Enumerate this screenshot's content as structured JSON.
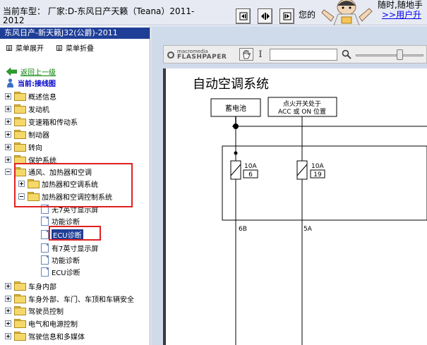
{
  "header": {
    "model_line1": "当前车型：  厂家:D-东风日产天籁（Teana）2011-",
    "model_line2": "2012",
    "notice_fragment": "您的",
    "slogan": "随时,随地手",
    "user_center": ">>用户升"
  },
  "sidebar": {
    "title": "东风日产-新天籁J32(公爵)-2011",
    "expand_all": "菜单展开",
    "collapse_all": "菜单折叠",
    "back": "返回上一级",
    "current": "当前:接线图",
    "items": [
      {
        "label": "概述信息"
      },
      {
        "label": "发动机"
      },
      {
        "label": "变速箱和传动系"
      },
      {
        "label": "制动器"
      },
      {
        "label": "转向"
      },
      {
        "label": "保护系统"
      },
      {
        "label": "通风、加热器和空调"
      },
      {
        "label": "加热器和空调系统"
      },
      {
        "label": "加热器和空调控制系统"
      },
      {
        "label": "无7英寸显示屏"
      },
      {
        "label": "功能诊断"
      },
      {
        "label": "ECU诊断"
      },
      {
        "label": "有7英寸显示屏"
      },
      {
        "label": "功能诊断"
      },
      {
        "label": "ECU诊断"
      },
      {
        "label": "车身内部"
      },
      {
        "label": "车身外部、车门、车顶和车辆安全"
      },
      {
        "label": "驾驶员控制"
      },
      {
        "label": "电气和电源控制"
      },
      {
        "label": "驾驶信息和多媒体"
      }
    ]
  },
  "viewer": {
    "logo_brand": "macromedia",
    "logo_product": "FLASHPAPER",
    "search_value": "",
    "zoom_level": 0.65
  },
  "document": {
    "title": "自动空调系统",
    "battery_label": "蓄电池",
    "ignition_label_1": "点火开关处于",
    "ignition_label_2": "ACC 或 ON 位置",
    "fuses": [
      {
        "amps": "10A",
        "number": "6",
        "wire": "6B"
      },
      {
        "amps": "10A",
        "number": "19",
        "wire": "5A"
      }
    ]
  },
  "colors": {
    "highlight_box": "#e02020",
    "sidebar_title_bg": "#1f3f97",
    "viewer_bg": "#cfdaeb"
  }
}
